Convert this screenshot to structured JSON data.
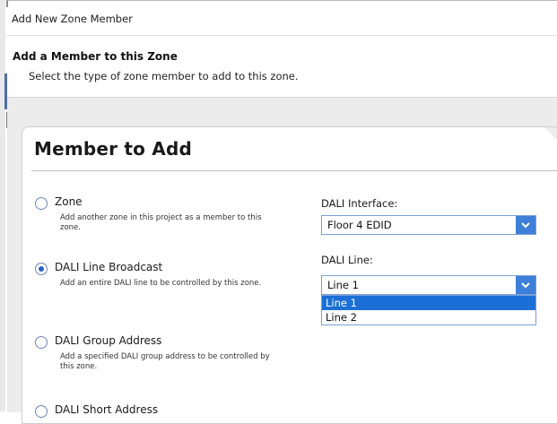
{
  "window": {
    "title": "Add New Zone Member"
  },
  "header": {
    "title": "Add a Member to this Zone",
    "subtitle": "Select the type of zone member to add to this zone."
  },
  "panel": {
    "title": "Member to Add"
  },
  "options": [
    {
      "label": "Zone",
      "desc": "Add another zone in this project as a member to this zone.",
      "checked": false
    },
    {
      "label": "DALI Line Broadcast",
      "desc": "Add an entire DALI line to be controlled by this zone.",
      "checked": true
    },
    {
      "label": "DALI Group Address",
      "desc": "Add a specified DALI group address to be controlled by this zone.",
      "checked": false
    },
    {
      "label": "DALI Short Address",
      "desc": "",
      "checked": false
    }
  ],
  "dali_interface": {
    "label": "DALI Interface:",
    "value": "Floor 4 EDID"
  },
  "dali_line": {
    "label": "DALI Line:",
    "value": "Line 1",
    "items": [
      {
        "label": "Line 1",
        "selected": true
      },
      {
        "label": "Line 2",
        "selected": false
      }
    ]
  },
  "colors": {
    "accent": "#3d7fd9",
    "selection": "#1b6fd6",
    "radio_checked": "#2a64c8"
  },
  "icons": {
    "combo_arrow": "chevron-down-icon"
  }
}
